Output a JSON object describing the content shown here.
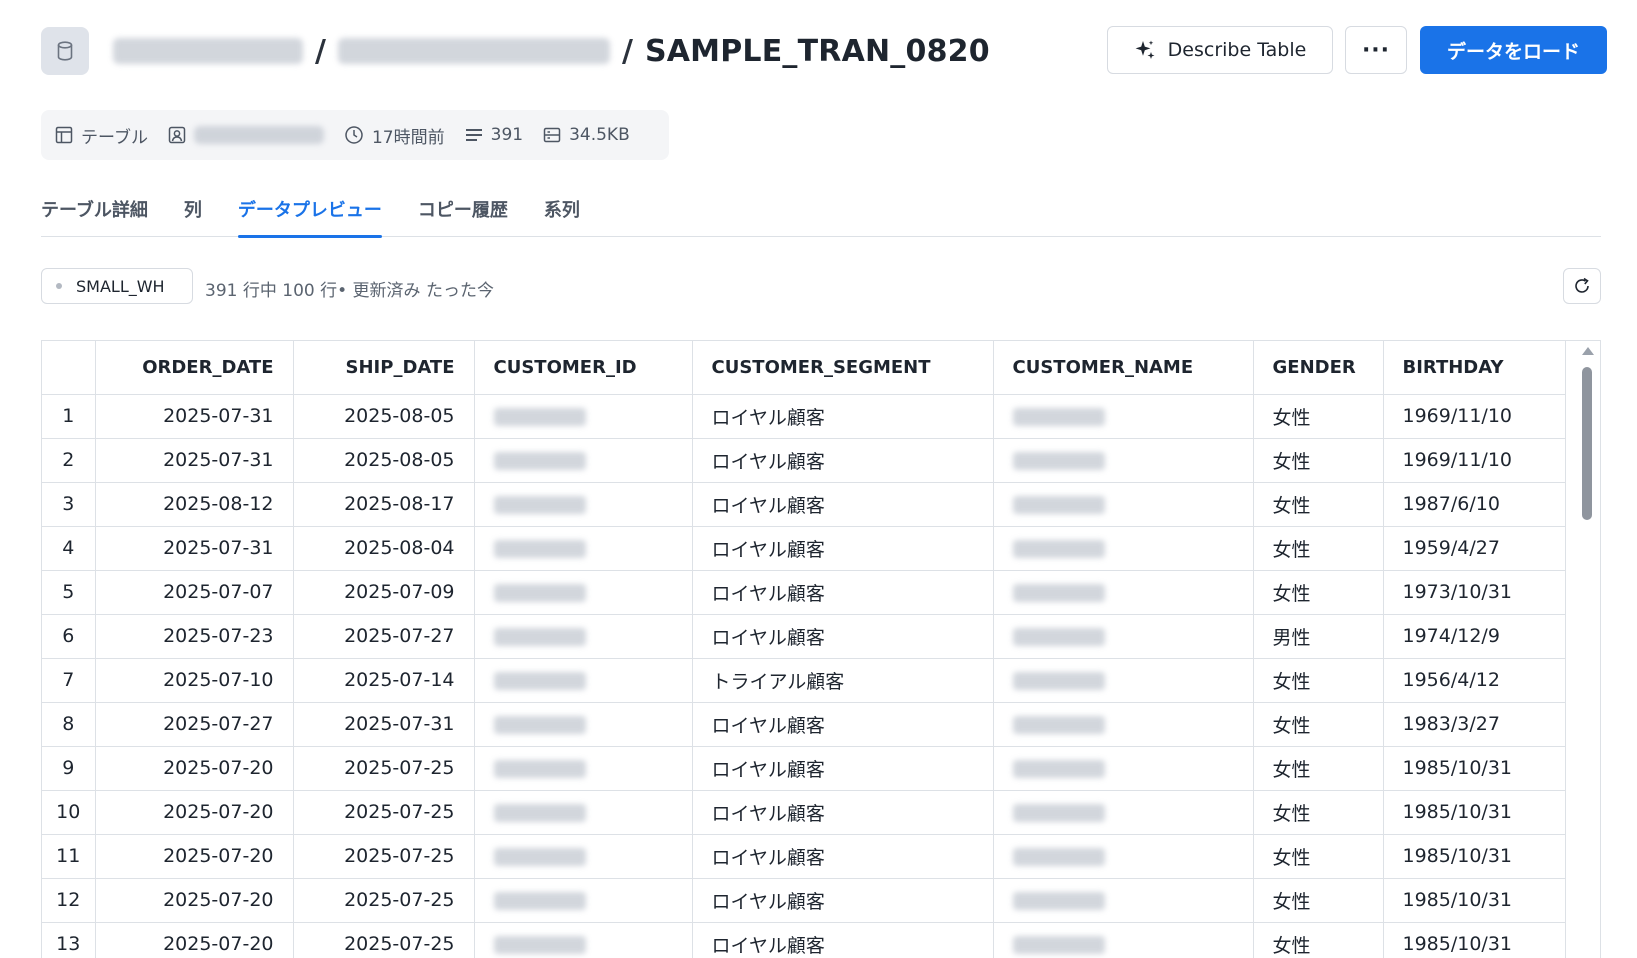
{
  "header": {
    "title": "SAMPLE_TRAN_0820",
    "breadcrumb_separator": "/",
    "describe_button": "Describe Table",
    "more_button": "···",
    "load_button": "データをロード"
  },
  "meta": {
    "type_label": "テーブル",
    "updated": "17時間前",
    "rows": "391",
    "size": "34.5KB"
  },
  "tabs": [
    {
      "label": "テーブル詳細"
    },
    {
      "label": "列"
    },
    {
      "label": "データプレビュー"
    },
    {
      "label": "コピー履歴"
    },
    {
      "label": "系列"
    }
  ],
  "toolbar": {
    "warehouse": "SMALL_WH",
    "row_info": "391 行中 100 行• 更新済み たった今"
  },
  "table": {
    "columns": [
      "",
      "ORDER_DATE",
      "SHIP_DATE",
      "CUSTOMER_ID",
      "CUSTOMER_SEGMENT",
      "CUSTOMER_NAME",
      "GENDER",
      "BIRTHDAY"
    ],
    "rows": [
      {
        "idx": "1",
        "order_date": "2025-07-31",
        "ship_date": "2025-08-05",
        "segment": "ロイヤル顧客",
        "gender": "女性",
        "birthday": "1969/11/10"
      },
      {
        "idx": "2",
        "order_date": "2025-07-31",
        "ship_date": "2025-08-05",
        "segment": "ロイヤル顧客",
        "gender": "女性",
        "birthday": "1969/11/10"
      },
      {
        "idx": "3",
        "order_date": "2025-08-12",
        "ship_date": "2025-08-17",
        "segment": "ロイヤル顧客",
        "gender": "女性",
        "birthday": "1987/6/10"
      },
      {
        "idx": "4",
        "order_date": "2025-07-31",
        "ship_date": "2025-08-04",
        "segment": "ロイヤル顧客",
        "gender": "女性",
        "birthday": "1959/4/27"
      },
      {
        "idx": "5",
        "order_date": "2025-07-07",
        "ship_date": "2025-07-09",
        "segment": "ロイヤル顧客",
        "gender": "女性",
        "birthday": "1973/10/31"
      },
      {
        "idx": "6",
        "order_date": "2025-07-23",
        "ship_date": "2025-07-27",
        "segment": "ロイヤル顧客",
        "gender": "男性",
        "birthday": "1974/12/9"
      },
      {
        "idx": "7",
        "order_date": "2025-07-10",
        "ship_date": "2025-07-14",
        "segment": "トライアル顧客",
        "gender": "女性",
        "birthday": "1956/4/12"
      },
      {
        "idx": "8",
        "order_date": "2025-07-27",
        "ship_date": "2025-07-31",
        "segment": "ロイヤル顧客",
        "gender": "女性",
        "birthday": "1983/3/27"
      },
      {
        "idx": "9",
        "order_date": "2025-07-20",
        "ship_date": "2025-07-25",
        "segment": "ロイヤル顧客",
        "gender": "女性",
        "birthday": "1985/10/31"
      },
      {
        "idx": "10",
        "order_date": "2025-07-20",
        "ship_date": "2025-07-25",
        "segment": "ロイヤル顧客",
        "gender": "女性",
        "birthday": "1985/10/31"
      },
      {
        "idx": "11",
        "order_date": "2025-07-20",
        "ship_date": "2025-07-25",
        "segment": "ロイヤル顧客",
        "gender": "女性",
        "birthday": "1985/10/31"
      },
      {
        "idx": "12",
        "order_date": "2025-07-20",
        "ship_date": "2025-07-25",
        "segment": "ロイヤル顧客",
        "gender": "女性",
        "birthday": "1985/10/31"
      },
      {
        "idx": "13",
        "order_date": "2025-07-20",
        "ship_date": "2025-07-25",
        "segment": "ロイヤル顧客",
        "gender": "女性",
        "birthday": "1985/10/31"
      }
    ]
  },
  "icons": {
    "database": "database-icon",
    "sparkle": "sparkle-icon",
    "table": "table-icon",
    "owner": "user-badge-icon",
    "clock": "clock-icon",
    "rows": "rows-icon",
    "storage": "storage-icon",
    "refresh": "refresh-icon"
  },
  "colors": {
    "accent": "#1a73e8",
    "text": "#1e252f",
    "muted": "#4d5663"
  }
}
